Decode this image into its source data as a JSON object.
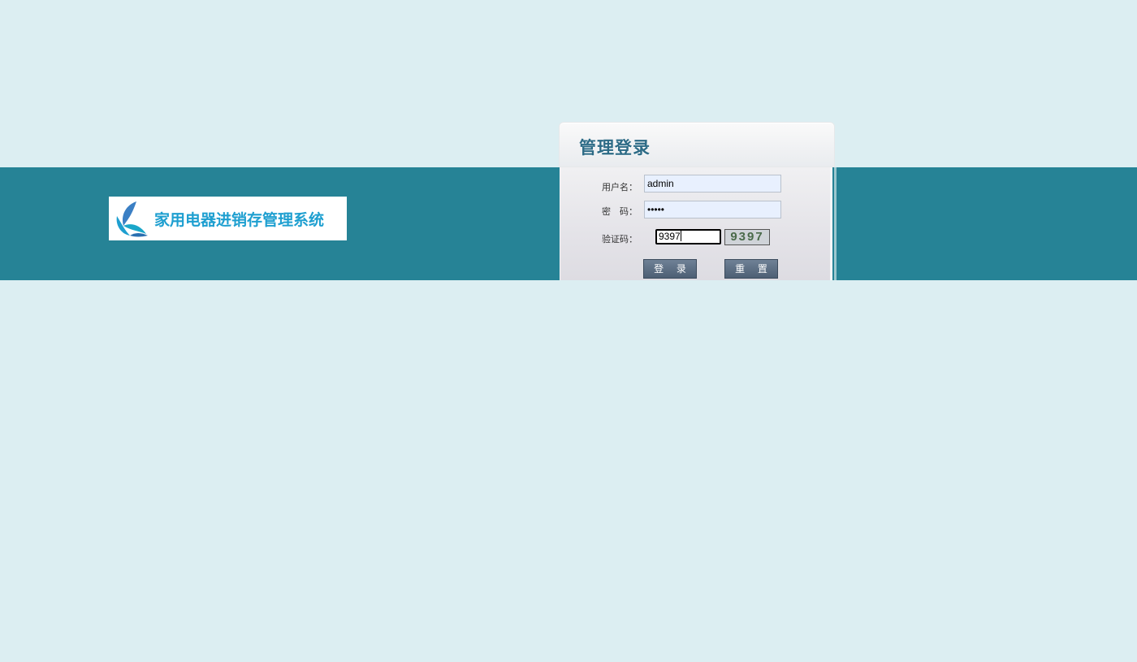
{
  "brand": {
    "logo_text": "家用电器进销存管理系统",
    "logo_icon": "butterfly-logo-icon",
    "accent_color": "#268396",
    "background_color": "#dceef2"
  },
  "login": {
    "title": "管理登录",
    "username_label": "用户名：",
    "username_value": "admin",
    "password_label": "密　码：",
    "password_value": "•••••",
    "captcha_label": "验证码：",
    "captcha_value": "9397",
    "captcha_image_text": "9397",
    "login_button": "登 录",
    "reset_button": "重 置"
  }
}
